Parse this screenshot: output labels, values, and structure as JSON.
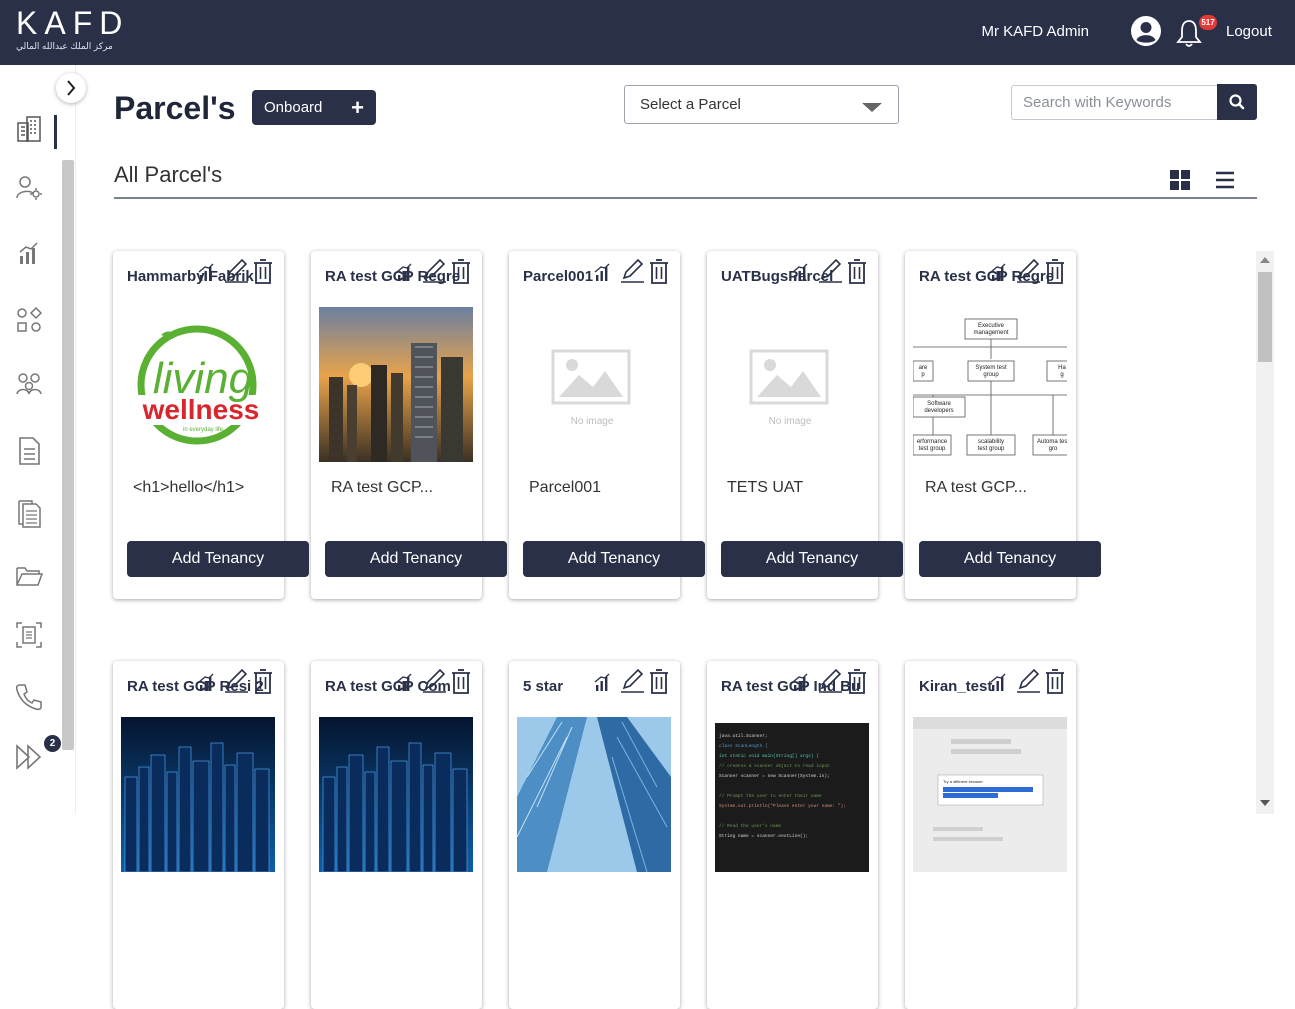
{
  "header": {
    "logo_text": "KAFD",
    "logo_subtitle": "مركز الملك عبدالله المالي",
    "user_name": "Mr KAFD Admin",
    "notification_count": "517",
    "logout_label": "Logout"
  },
  "sidebar": {
    "items": [
      "buildings-icon",
      "user-settings-icon",
      "analytics-icon",
      "shapes-icon",
      "group-icon",
      "document-icon",
      "documents-icon",
      "folder-icon",
      "scan-document-icon",
      "phone-icon",
      "fast-forward-icon"
    ],
    "badge_count": "2"
  },
  "toolbar": {
    "page_title": "Parcel's",
    "onboard_label": "Onboard",
    "onboard_plus": "+",
    "select_placeholder": "Select a Parcel",
    "search_placeholder": "Search with Keywords"
  },
  "section": {
    "title": "All Parcel's"
  },
  "cards": [
    {
      "name": "Hammarby Fabrik",
      "description": "<h1>hello</h1>",
      "button": "Add Tenancy",
      "image": "living-wellness-logo"
    },
    {
      "name": "RA test GCP Regre",
      "description": "RA test GCP...",
      "button": "Add Tenancy",
      "image": "city-skyline-sunset"
    },
    {
      "name": "Parcel001",
      "description": "Parcel001",
      "button": "Add Tenancy",
      "image": "no-image",
      "image_label": "No image"
    },
    {
      "name": "UATBugsParcel",
      "description": "TETS UAT",
      "button": "Add Tenancy",
      "image": "no-image",
      "image_label": "No image"
    },
    {
      "name": "RA test GCP Regre",
      "description": "RA test GCP...",
      "button": "Add Tenancy",
      "image": "org-chart"
    },
    {
      "name": "RA test GCP Resi 2",
      "description": "",
      "button": "",
      "image": "night-city"
    },
    {
      "name": "RA test GCP Com",
      "description": "",
      "button": "",
      "image": "night-city"
    },
    {
      "name": "5 star",
      "description": "",
      "button": "",
      "image": "glass-towers"
    },
    {
      "name": "RA test GCP Ind Bu",
      "description": "",
      "button": "",
      "image": "code-screenshot"
    },
    {
      "name": "Kiran_test",
      "description": "",
      "button": "",
      "image": "dialog-screenshot"
    }
  ],
  "org_chart": {
    "top": "Executive management",
    "middle": "System test group",
    "left_partial": "are p",
    "right_partial": "Ha g",
    "software": "Software developers",
    "bottom_left": "erformance test group",
    "bottom_mid": "scalability test group",
    "bottom_right": "Automa test gro"
  },
  "code_snippet": [
    "java.util.Scanner;",
    "class ScanLength {",
    "  int static void main(String[] args) {",
    "  // creates a scanner object to read input",
    "  Scanner scanner = new Scanner(System.in);",
    "",
    "  // Prompt the user to enter their name",
    "  System.out.println(\"Please enter your name: \");",
    "",
    "  // Read the user's name",
    "  String name = scanner.nextLine();"
  ],
  "dialog_snippet": {
    "title": "Try a different browser",
    "highlight": "selected text"
  },
  "colors": {
    "navy": "#293048",
    "badge_red": "#e53935",
    "logo_green": "#5ab033",
    "logo_red": "#d9252b"
  }
}
